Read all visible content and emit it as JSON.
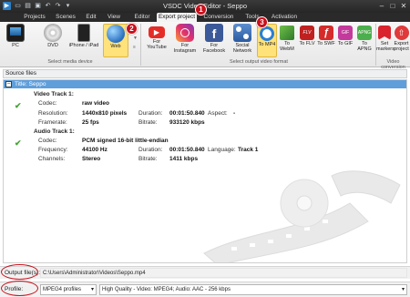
{
  "window": {
    "title": "VSDC Video Editor - Seppo"
  },
  "tabs": [
    "Projects",
    "Scenes",
    "Edit",
    "View",
    "Editor",
    "Export project",
    "Conversion",
    "Tools",
    "Activation"
  ],
  "ribbon": {
    "media_buttons": [
      {
        "label": "PC"
      },
      {
        "label": "DVD"
      },
      {
        "label": "iPhone / iPad"
      },
      {
        "label": "Web"
      }
    ],
    "media_group_label": "Select media device",
    "format_buttons": [
      {
        "label": "For YouTube"
      },
      {
        "label": "For Instagram"
      },
      {
        "label": "For Facebook"
      },
      {
        "label": "Social Network"
      },
      {
        "label": "To MP4"
      },
      {
        "label": "To WebM"
      },
      {
        "label": "To FLV"
      },
      {
        "label": "To SWF"
      },
      {
        "label": "To GIF"
      },
      {
        "label": "To APNG"
      }
    ],
    "format_group_label": "Select output video format",
    "conv_buttons": [
      {
        "label": "Set markers"
      },
      {
        "label": "Export project"
      }
    ],
    "conv_group_label": "Video conversion",
    "colors": {
      "accent": "#ffe27a",
      "badge": "#c8101c"
    }
  },
  "badges": [
    "1",
    "2",
    "3"
  ],
  "source": {
    "header": "Source files",
    "title_row": "Title: Seppo",
    "video_track": {
      "title": "Video Track 1:",
      "codec_label": "Codec:",
      "codec": "raw video",
      "resolution_label": "Resolution:",
      "resolution": "1440x810 pixels",
      "duration_label": "Duration:",
      "duration": "00:01:50.840",
      "aspect_label": "Aspect:",
      "aspect": "-",
      "framerate_label": "Framerate:",
      "framerate": "25 fps",
      "bitrate_label": "Bitrate:",
      "bitrate": "933120 kbps"
    },
    "audio_track": {
      "title": "Audio Track 1:",
      "codec_label": "Codec:",
      "codec": "PCM signed 16-bit little-endian",
      "frequency_label": "Frequency:",
      "frequency": "44100 Hz",
      "duration_label": "Duration:",
      "duration": "00:01:50.840",
      "language_label": "Language:",
      "language": "Track 1",
      "channels_label": "Channels:",
      "channels": "Stereo",
      "bitrate_label": "Bitrate:",
      "bitrate": "1411 kbps"
    }
  },
  "output": {
    "label": "Output file(s):",
    "path": "C:\\Users\\Administrator\\Videos\\Seppo.mp4"
  },
  "profile": {
    "label": "Profile:",
    "selected": "MPEG4 profiles",
    "quality": "High Quality - Video: MPEG4; Audio: AAC - 256 kbps"
  }
}
